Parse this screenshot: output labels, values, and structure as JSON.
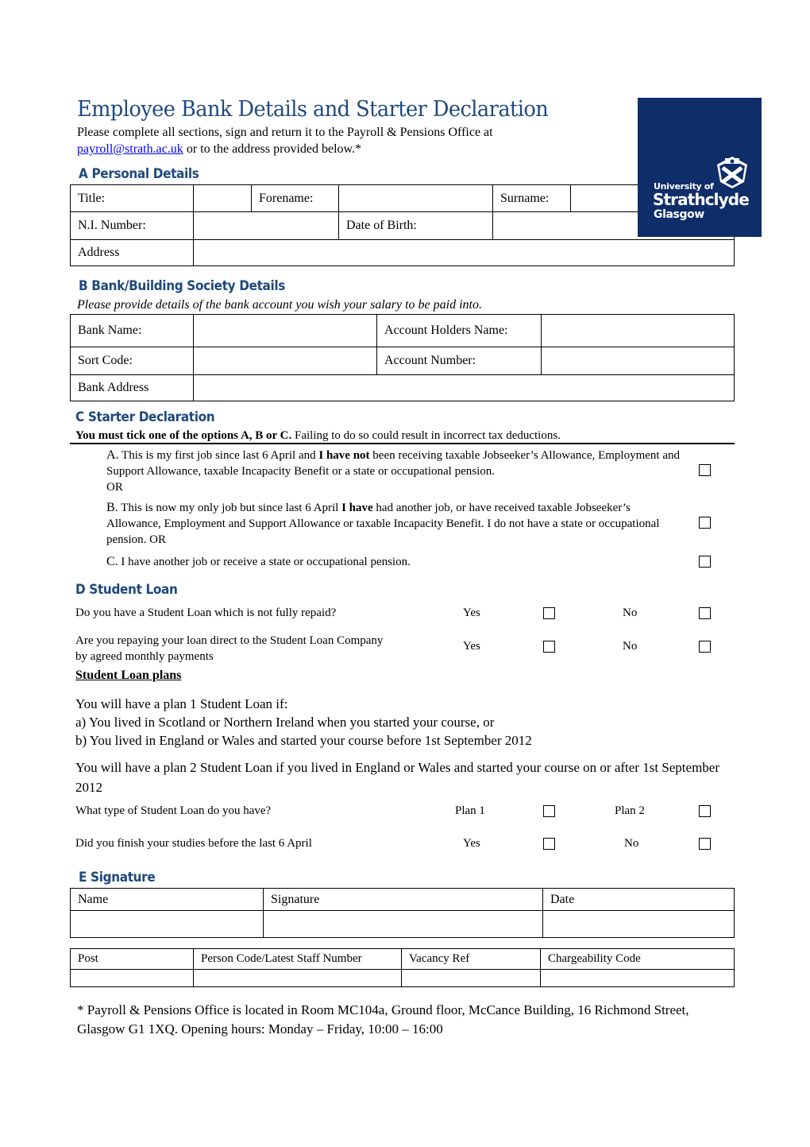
{
  "header": {
    "title": "Employee Bank Details and Starter Declaration",
    "intro_line1": "Please complete all sections, sign and return it to the Payroll & Pensions Office at",
    "email_link": "payroll@strath.ac.uk",
    "intro_line2_rest": " or to the address provided below.*"
  },
  "logo": {
    "line1": "University of",
    "line2": "Strathclyde",
    "line3": "Glasgow",
    "bg_color": "#0f2d69"
  },
  "section_a": {
    "heading": "A  Personal Details",
    "labels": {
      "title": "Title:",
      "forename": "Forename:",
      "surname": "Surname:",
      "ni_number": "N.I. Number:",
      "dob": "Date of Birth:",
      "address": "Address"
    }
  },
  "section_b": {
    "heading": "B  Bank/Building Society Details",
    "subtitle": "Please provide details of the bank account you wish your salary to be paid into.",
    "labels": {
      "bank_name": "Bank Name:",
      "account_holders_name": "Account Holders Name:",
      "sort_code": "Sort Code:",
      "account_number": "Account Number:",
      "bank_address": "Bank Address"
    }
  },
  "section_c": {
    "heading": "C  Starter Declaration",
    "instruction_bold": "You must tick one of the options A, B or C.",
    "instruction_rest": " Failing to do so could result in incorrect tax deductions.",
    "options": [
      {
        "letter": "A.",
        "pre": " This is my first job since last 6 April and ",
        "bold": "I have not",
        "post": " been receiving taxable Jobseeker’s Allowance, Employment and Support Allowance, taxable Incapacity Benefit or a state or occupational pension.",
        "tail": "OR"
      },
      {
        "letter": "B.",
        "pre": " This is now my only job but since last 6 April ",
        "bold": "I have",
        "post": " had another job, or have received taxable Jobseeker’s Allowance, Employment and Support Allowance or taxable Incapacity Benefit. I do not have a state or occupational pension. OR",
        "tail": ""
      },
      {
        "letter": "C.",
        "pre": " I have another job or receive a state or occupational pension.",
        "bold": "",
        "post": "",
        "tail": ""
      }
    ]
  },
  "section_d": {
    "heading": "D  Student Loan",
    "questions": [
      {
        "text": "Do you have a Student Loan which is not fully repaid?",
        "opt1": "Yes",
        "opt2": "No"
      },
      {
        "text_line1": "Are you repaying your loan direct to the Student Loan Company",
        "text_line2": "by agreed monthly payments",
        "opt1": "Yes",
        "opt2": "No"
      }
    ],
    "plans_heading": "Student Loan plans",
    "plan1_intro": "You will have a plan 1 Student Loan if:",
    "plan1_a": "a) You lived in Scotland or Northern Ireland when you started your course, or",
    "plan1_b": "b) You lived in England or Wales and started your course before 1st September 2012",
    "plan2": "You will have a plan 2 Student Loan if you lived in England or Wales and started your course on or after 1st September 2012",
    "type_question": {
      "text": "What type of Student Loan do you have?",
      "opt1": "Plan 1",
      "opt2": "Plan 2"
    },
    "finish_question": {
      "text": "Did you finish your studies before the last 6 April",
      "opt1": "Yes",
      "opt2": "No"
    }
  },
  "section_e": {
    "heading": "E  Signature",
    "sig_headers": [
      "Name",
      "Signature",
      "Date"
    ],
    "office_headers": [
      "Post",
      "Person Code/Latest Staff Number",
      "Vacancy Ref",
      "Chargeability Code"
    ]
  },
  "footer": {
    "note": "* Payroll & Pensions Office is located in Room MC104a, Ground floor, McCance Building, 16 Richmond Street, Glasgow G1 1XQ.  Opening hours: Monday – Friday, 10:00 – 16:00"
  }
}
